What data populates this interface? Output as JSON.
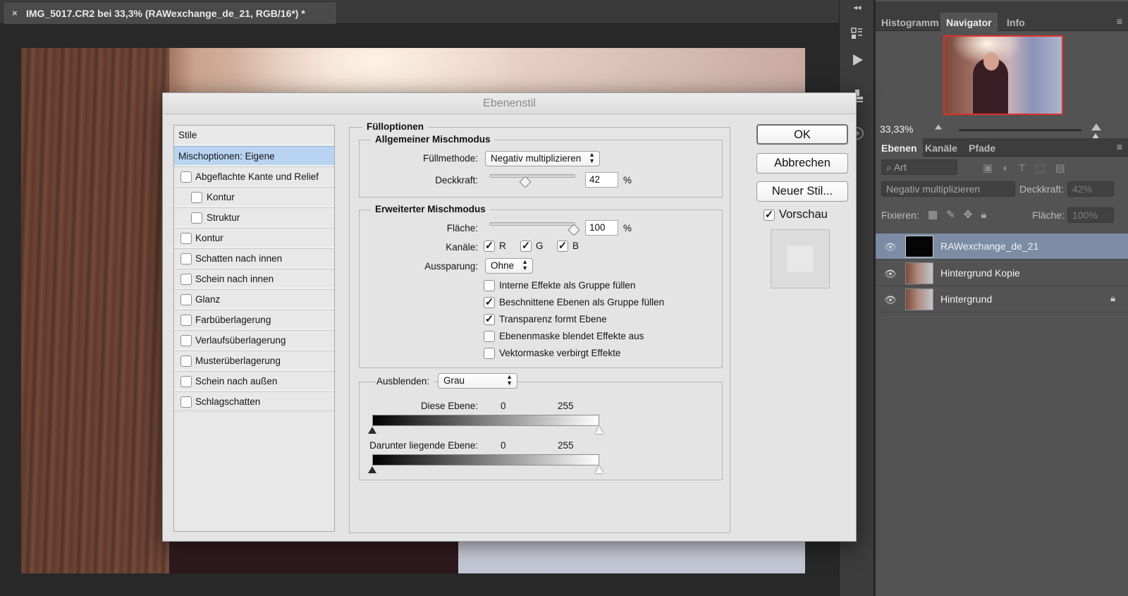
{
  "document": {
    "tab_title": "IMG_5017.CR2 bei 33,3% (RAWexchange_de_21, RGB/16*) *",
    "close_glyph": "×"
  },
  "toolbar_strip": {
    "icons": [
      "history-icon",
      "play-action-icon",
      "stamp-icon",
      "swatch-icon"
    ],
    "collapse_glyph": "◂◂"
  },
  "navigator_panel": {
    "tabs": [
      "Histogramm",
      "Navigator",
      "Info"
    ],
    "active_tab": "Navigator",
    "zoom": "33,33%",
    "menu_glyph": "≡"
  },
  "layers_panel": {
    "tabs": [
      "Ebenen",
      "Kanäle",
      "Pfade"
    ],
    "active_tab": "Ebenen",
    "filter_label": "Art",
    "blend_mode": "Negativ multiplizieren",
    "opacity_label": "Deckkraft:",
    "opacity_value": "42%",
    "lock_label": "Fixieren:",
    "fill_label": "Fläche:",
    "fill_value": "100%",
    "layers": [
      {
        "name": "RAWexchange_de_21",
        "selected": true,
        "locked": false
      },
      {
        "name": "Hintergrund Kopie",
        "selected": false,
        "locked": false
      },
      {
        "name": "Hintergrund",
        "selected": false,
        "locked": true
      }
    ]
  },
  "dialog": {
    "title": "Ebenenstil",
    "styles_header": "Stile",
    "styles": [
      {
        "label": "Mischoptionen: Eigene",
        "selected": true,
        "has_checkbox": false,
        "indent": 0
      },
      {
        "label": "Abgeflachte Kante und Relief",
        "selected": false,
        "has_checkbox": true,
        "checked": false,
        "indent": 0
      },
      {
        "label": "Kontur",
        "selected": false,
        "has_checkbox": true,
        "checked": false,
        "indent": 1
      },
      {
        "label": "Struktur",
        "selected": false,
        "has_checkbox": true,
        "checked": false,
        "indent": 1
      },
      {
        "label": "Kontur",
        "selected": false,
        "has_checkbox": true,
        "checked": false,
        "indent": 0
      },
      {
        "label": "Schatten nach innen",
        "selected": false,
        "has_checkbox": true,
        "checked": false,
        "indent": 0
      },
      {
        "label": "Schein nach innen",
        "selected": false,
        "has_checkbox": true,
        "checked": false,
        "indent": 0
      },
      {
        "label": "Glanz",
        "selected": false,
        "has_checkbox": true,
        "checked": false,
        "indent": 0
      },
      {
        "label": "Farbüberlagerung",
        "selected": false,
        "has_checkbox": true,
        "checked": false,
        "indent": 0
      },
      {
        "label": "Verlaufsüberlagerung",
        "selected": false,
        "has_checkbox": true,
        "checked": false,
        "indent": 0
      },
      {
        "label": "Musterüberlagerung",
        "selected": false,
        "has_checkbox": true,
        "checked": false,
        "indent": 0
      },
      {
        "label": "Schein nach außen",
        "selected": false,
        "has_checkbox": true,
        "checked": false,
        "indent": 0
      },
      {
        "label": "Schlagschatten",
        "selected": false,
        "has_checkbox": true,
        "checked": false,
        "indent": 0
      }
    ],
    "fill_options": {
      "title": "Fülloptionen",
      "general": {
        "title": "Allgemeiner Mischmodus",
        "blend_label": "Füllmethode:",
        "blend_value": "Negativ multiplizieren",
        "opacity_label": "Deckkraft:",
        "opacity_value": "42",
        "percent": "%"
      },
      "advanced": {
        "title": "Erweiterter Mischmodus",
        "fill_label": "Fläche:",
        "fill_value": "100",
        "percent": "%",
        "channels_label": "Kanäle:",
        "channels": [
          {
            "label": "R",
            "checked": true
          },
          {
            "label": "G",
            "checked": true
          },
          {
            "label": "B",
            "checked": true
          }
        ],
        "knockout_label": "Aussparung:",
        "knockout_value": "Ohne",
        "options": [
          {
            "label": "Interne Effekte als Gruppe füllen",
            "checked": false
          },
          {
            "label": "Beschnittene Ebenen als Gruppe füllen",
            "checked": true
          },
          {
            "label": "Transparenz formt Ebene",
            "checked": true
          },
          {
            "label": "Ebenenmaske blendet Effekte aus",
            "checked": false
          },
          {
            "label": "Vektormaske verbirgt Effekte",
            "checked": false
          }
        ]
      },
      "blend_if": {
        "label": "Ausblenden:",
        "value": "Grau",
        "this_layer_label": "Diese Ebene:",
        "this_layer_min": "0",
        "this_layer_max": "255",
        "underlying_label": "Darunter liegende Ebene:",
        "underlying_min": "0",
        "underlying_max": "255"
      }
    },
    "buttons": {
      "ok": "OK",
      "cancel": "Abbrechen",
      "new_style": "Neuer Stil...",
      "preview_label": "Vorschau",
      "preview_checked": true
    }
  },
  "colors": {
    "selection_blue": "#b9d4f2",
    "layer_selected": "#7b8ca4",
    "navigator_frame": "#e0312b"
  }
}
